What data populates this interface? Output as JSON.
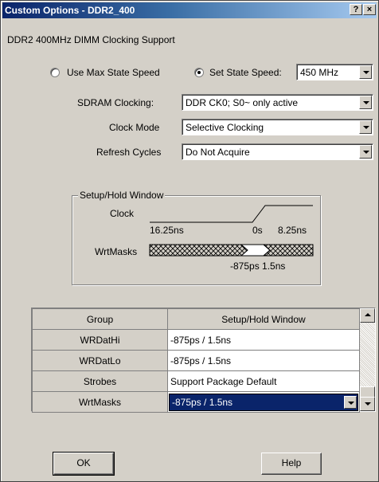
{
  "window": {
    "title": "Custom Options - DDR2_400",
    "help_glyph": "?",
    "close_glyph": "×"
  },
  "header": {
    "subtitle": "DDR2 400MHz DIMM Clocking Support"
  },
  "speed": {
    "option_max": "Use Max State Speed",
    "option_set": "Set State Speed:",
    "selected_option": "Set State Speed:",
    "value": "450 MHz"
  },
  "fields": [
    {
      "label": "SDRAM Clocking:",
      "value": "DDR CK0; S0~ only active"
    },
    {
      "label": "Clock Mode",
      "value": "Selective Clocking"
    },
    {
      "label": "Refresh Cycles",
      "value": "Do Not Acquire"
    }
  ],
  "timing": {
    "group_label": "Setup/Hold Window",
    "clock_label": "Clock",
    "clock_t_left": "16.25ns",
    "clock_t_mid": "0s",
    "clock_t_right": "8.25ns",
    "wrt_label": "WrtMasks",
    "window_text": "-875ps 1.5ns"
  },
  "grid": {
    "headers": [
      "Group",
      "Setup/Hold Window"
    ],
    "rows": [
      {
        "group": "WRDatHi",
        "window": "-875ps / 1.5ns"
      },
      {
        "group": "WRDatLo",
        "window": "-875ps / 1.5ns"
      },
      {
        "group": "Strobes",
        "window": "Support Package Default"
      },
      {
        "group": "WrtMasks",
        "window": "-875ps / 1.5ns"
      }
    ],
    "selected_row": "WrtMasks"
  },
  "buttons": {
    "ok": "OK",
    "help": "Help"
  },
  "colors": {
    "face": "#d4d0c8",
    "title_start": "#0a246a",
    "selection": "#0a246a"
  }
}
